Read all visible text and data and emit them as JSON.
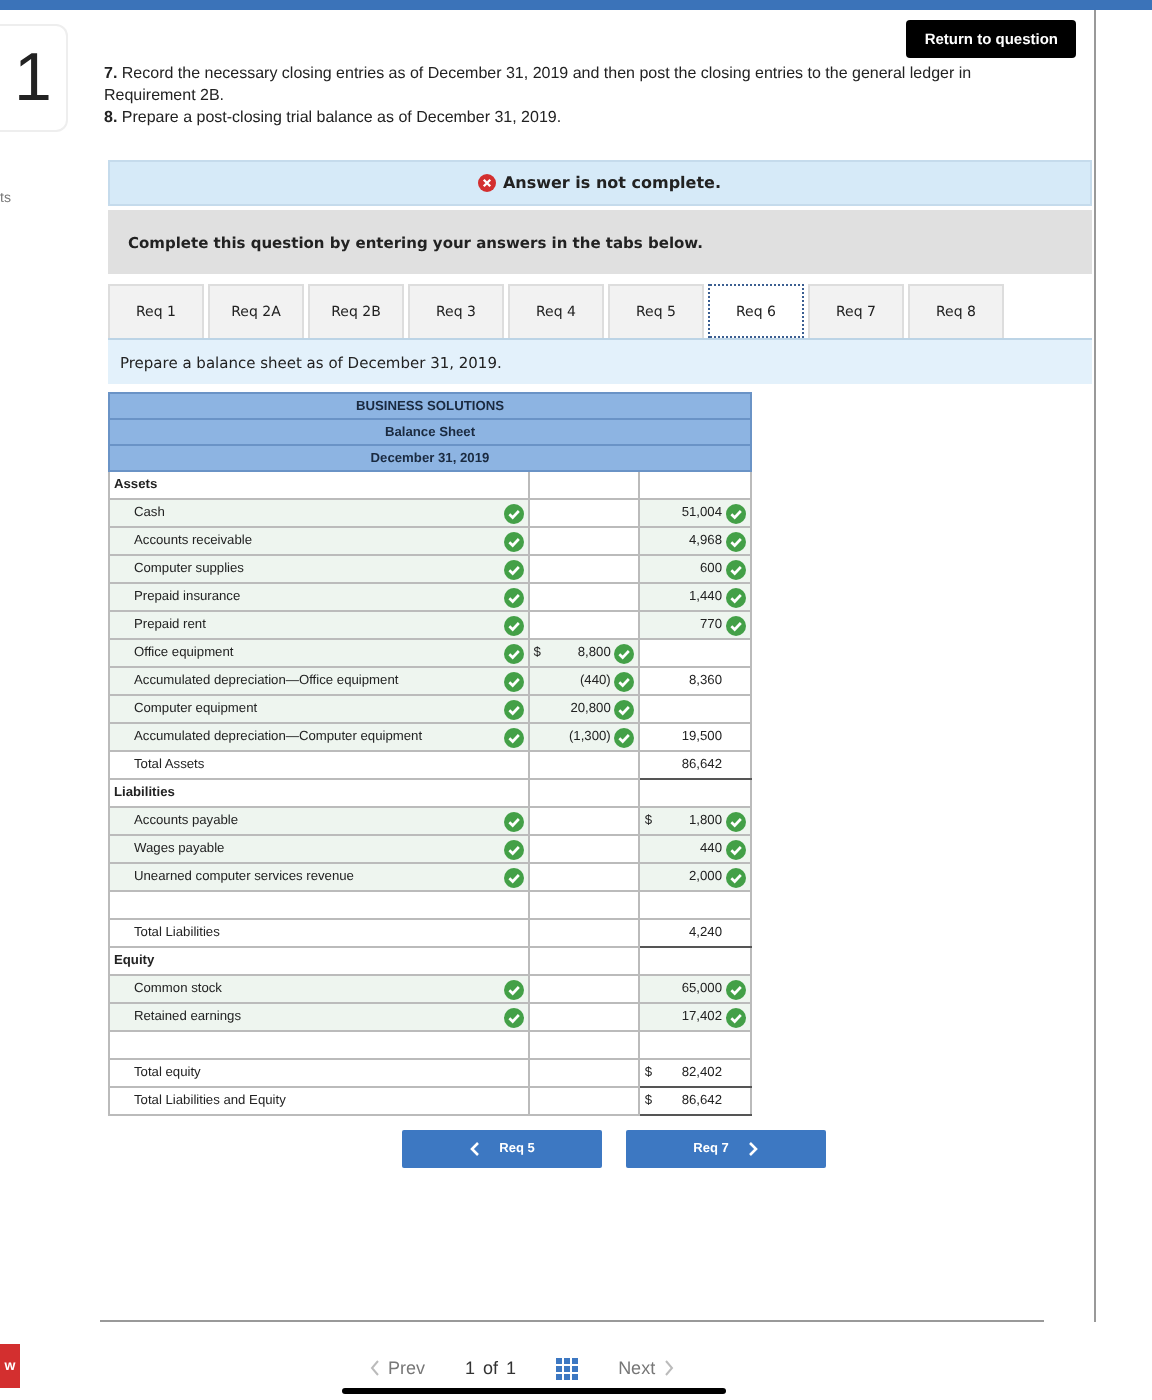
{
  "side": {
    "number": "1",
    "note": "ts",
    "badge": "w"
  },
  "return_button": "Return to question",
  "instructions": [
    "**7.** Record the necessary closing entries as of December 31, 2019 and then post the closing entries to the general ledger in Requirement 2B.",
    "**8.** Prepare a post-closing trial balance as of December 31, 2019."
  ],
  "status": {
    "text": "Answer is not complete.",
    "complete": false
  },
  "prompt_box": "Complete this question by entering your answers in the tabs below.",
  "tabs": [
    {
      "label": "Req 1",
      "selected": false
    },
    {
      "label": "Req 2A",
      "selected": false
    },
    {
      "label": "Req 2B",
      "selected": false
    },
    {
      "label": "Req 3",
      "selected": false
    },
    {
      "label": "Req 4",
      "selected": false
    },
    {
      "label": "Req 5",
      "selected": false
    },
    {
      "label": "Req 6",
      "selected": true
    },
    {
      "label": "Req 7",
      "selected": false
    },
    {
      "label": "Req 8",
      "selected": false
    }
  ],
  "task": "Prepare a balance sheet as of December 31, 2019.",
  "table": {
    "title": [
      "BUSINESS SOLUTIONS",
      "Balance Sheet",
      "December 31, 2019"
    ],
    "rows": [
      {
        "kind": "header",
        "label": "Assets"
      },
      {
        "kind": "item",
        "label": "Cash",
        "correct": true,
        "amount": "51,004",
        "amount_correct": true
      },
      {
        "kind": "item",
        "label": "Accounts receivable",
        "correct": true,
        "amount": "4,968",
        "amount_correct": true
      },
      {
        "kind": "item",
        "label": "Computer supplies",
        "correct": true,
        "amount": "600",
        "amount_correct": true
      },
      {
        "kind": "item",
        "label": "Prepaid insurance",
        "correct": true,
        "amount": "1,440",
        "amount_correct": true
      },
      {
        "kind": "item",
        "label": "Prepaid rent",
        "correct": true,
        "amount": "770",
        "amount_correct": true
      },
      {
        "kind": "item",
        "label": "Office equipment",
        "correct": true,
        "sub_currency": "$",
        "sub": "8,800",
        "sub_correct": true
      },
      {
        "kind": "item",
        "label": "Accumulated depreciation—Office equipment",
        "correct": true,
        "sub": "(440)",
        "sub_correct": true,
        "amount": "8,360",
        "amount_correct": false
      },
      {
        "kind": "item",
        "label": "Computer equipment",
        "correct": true,
        "sub": "20,800",
        "sub_correct": true
      },
      {
        "kind": "item",
        "label": "Accumulated depreciation—Computer equipment",
        "correct": true,
        "sub": "(1,300)",
        "sub_correct": true,
        "amount": "19,500",
        "amount_correct": false
      },
      {
        "kind": "total",
        "label": "Total Assets",
        "amount": "86,642",
        "amount_correct": false
      },
      {
        "kind": "header",
        "label": "Liabilities"
      },
      {
        "kind": "item",
        "label": "Accounts payable",
        "correct": true,
        "currency": "$",
        "amount": "1,800",
        "amount_correct": true
      },
      {
        "kind": "item",
        "label": "Wages payable",
        "correct": true,
        "amount": "440",
        "amount_correct": true
      },
      {
        "kind": "item",
        "label": "Unearned computer services revenue",
        "correct": true,
        "amount": "2,000",
        "amount_correct": true
      },
      {
        "kind": "blank"
      },
      {
        "kind": "total",
        "label": "Total Liabilities",
        "amount": "4,240",
        "amount_correct": false
      },
      {
        "kind": "header",
        "label": "Equity"
      },
      {
        "kind": "item",
        "label": "Common stock",
        "correct": true,
        "amount": "65,000",
        "amount_correct": true
      },
      {
        "kind": "item",
        "label": "Retained earnings",
        "correct": true,
        "amount": "17,402",
        "amount_correct": true
      },
      {
        "kind": "blank"
      },
      {
        "kind": "total",
        "label": "Total equity",
        "currency": "$",
        "amount": "82,402",
        "amount_correct": false
      },
      {
        "kind": "total",
        "label": "Total Liabilities and Equity",
        "currency": "$",
        "amount": "86,642",
        "amount_correct": false
      }
    ]
  },
  "nav": {
    "prev": "Req 5",
    "next": "Req 7"
  },
  "pager": {
    "prev": "Prev",
    "page": "1",
    "of": "of",
    "total": "1",
    "next": "Next"
  }
}
